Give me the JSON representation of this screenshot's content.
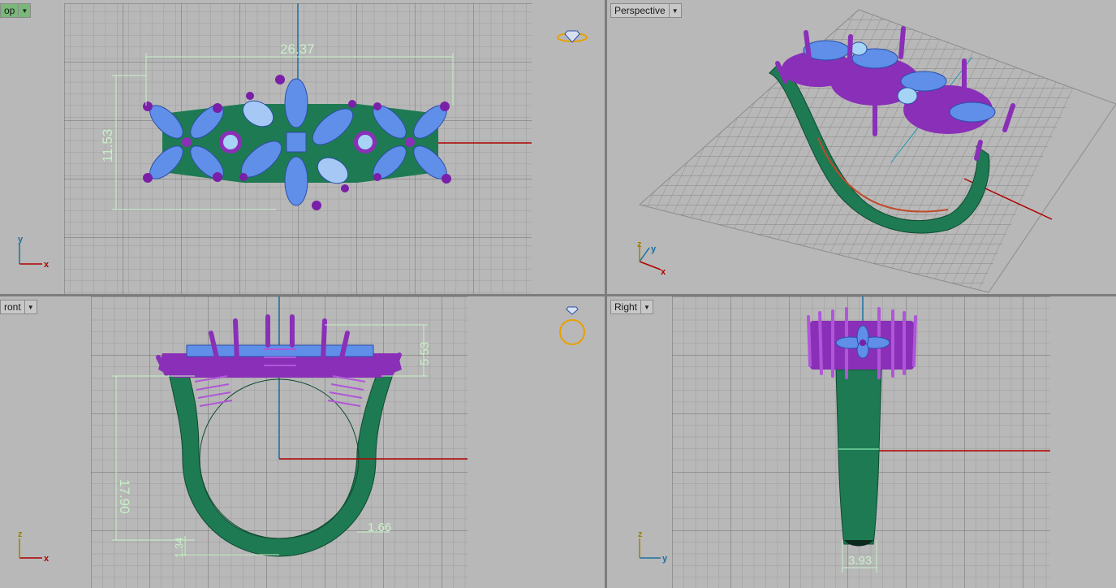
{
  "viewports": {
    "top": {
      "label": "op",
      "dimension_width": "26.37",
      "dimension_height": "11.53",
      "axis_x": "x",
      "axis_y": "y"
    },
    "perspective": {
      "label": "Perspective",
      "axis_x": "x",
      "axis_y": "y",
      "axis_z": "z"
    },
    "front": {
      "label": "ront",
      "dimension_height": "17.90",
      "dimension_top": "5.53",
      "dimension_band": "1.66",
      "dimension_bottom": "1.34",
      "axis_x": "x",
      "axis_z": "z"
    },
    "right": {
      "label": "Right",
      "dimension_width": "3.93",
      "axis_y": "y",
      "axis_z": "z"
    }
  },
  "colors": {
    "background": "#b8b8b8",
    "grid_minor": "#9c9c9c",
    "grid_major": "#6e6e6e",
    "metal_green": "#1e7a52",
    "prong_purple": "#8a2fb8",
    "gem_blue": "#5f8fe8",
    "dimension": "#c8f0c8",
    "x_axis": "#b00000",
    "y_axis": "#1a6fa0"
  },
  "icons": {
    "top_view_icon": "diamond-ring-icon",
    "front_view_icon": "ring-icon"
  }
}
